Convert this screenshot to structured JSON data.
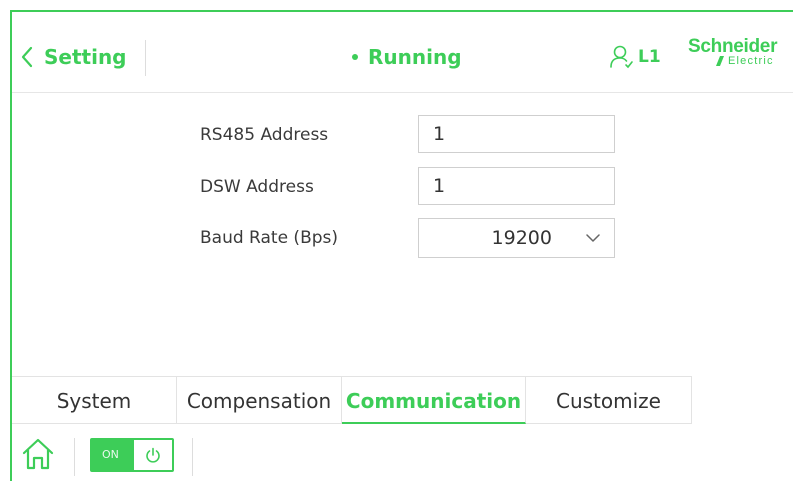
{
  "header": {
    "back_label": "Setting",
    "status_label": "Running",
    "user_level": "L1",
    "logo_top": "Schneider",
    "logo_bottom": "Electric"
  },
  "form": {
    "rs485_label": "RS485 Address",
    "rs485_value": "1",
    "dsw_label": "DSW Address",
    "dsw_value": "1",
    "baud_label": "Baud Rate (Bps)",
    "baud_value": "19200"
  },
  "tabs": [
    {
      "label": "System",
      "active": false
    },
    {
      "label": "Compensation",
      "active": false
    },
    {
      "label": "Communication",
      "active": true
    },
    {
      "label": "Customize",
      "active": false
    }
  ],
  "bottom": {
    "power_label": "ON",
    "power_state": "on"
  },
  "colors": {
    "accent": "#3dcd58",
    "border": "#cfcfcf"
  },
  "icons": {
    "back": "chevron-left-icon",
    "status": "dot-icon",
    "user": "user-icon",
    "select": "chevron-down-icon",
    "home": "home-icon",
    "power": "power-icon"
  }
}
